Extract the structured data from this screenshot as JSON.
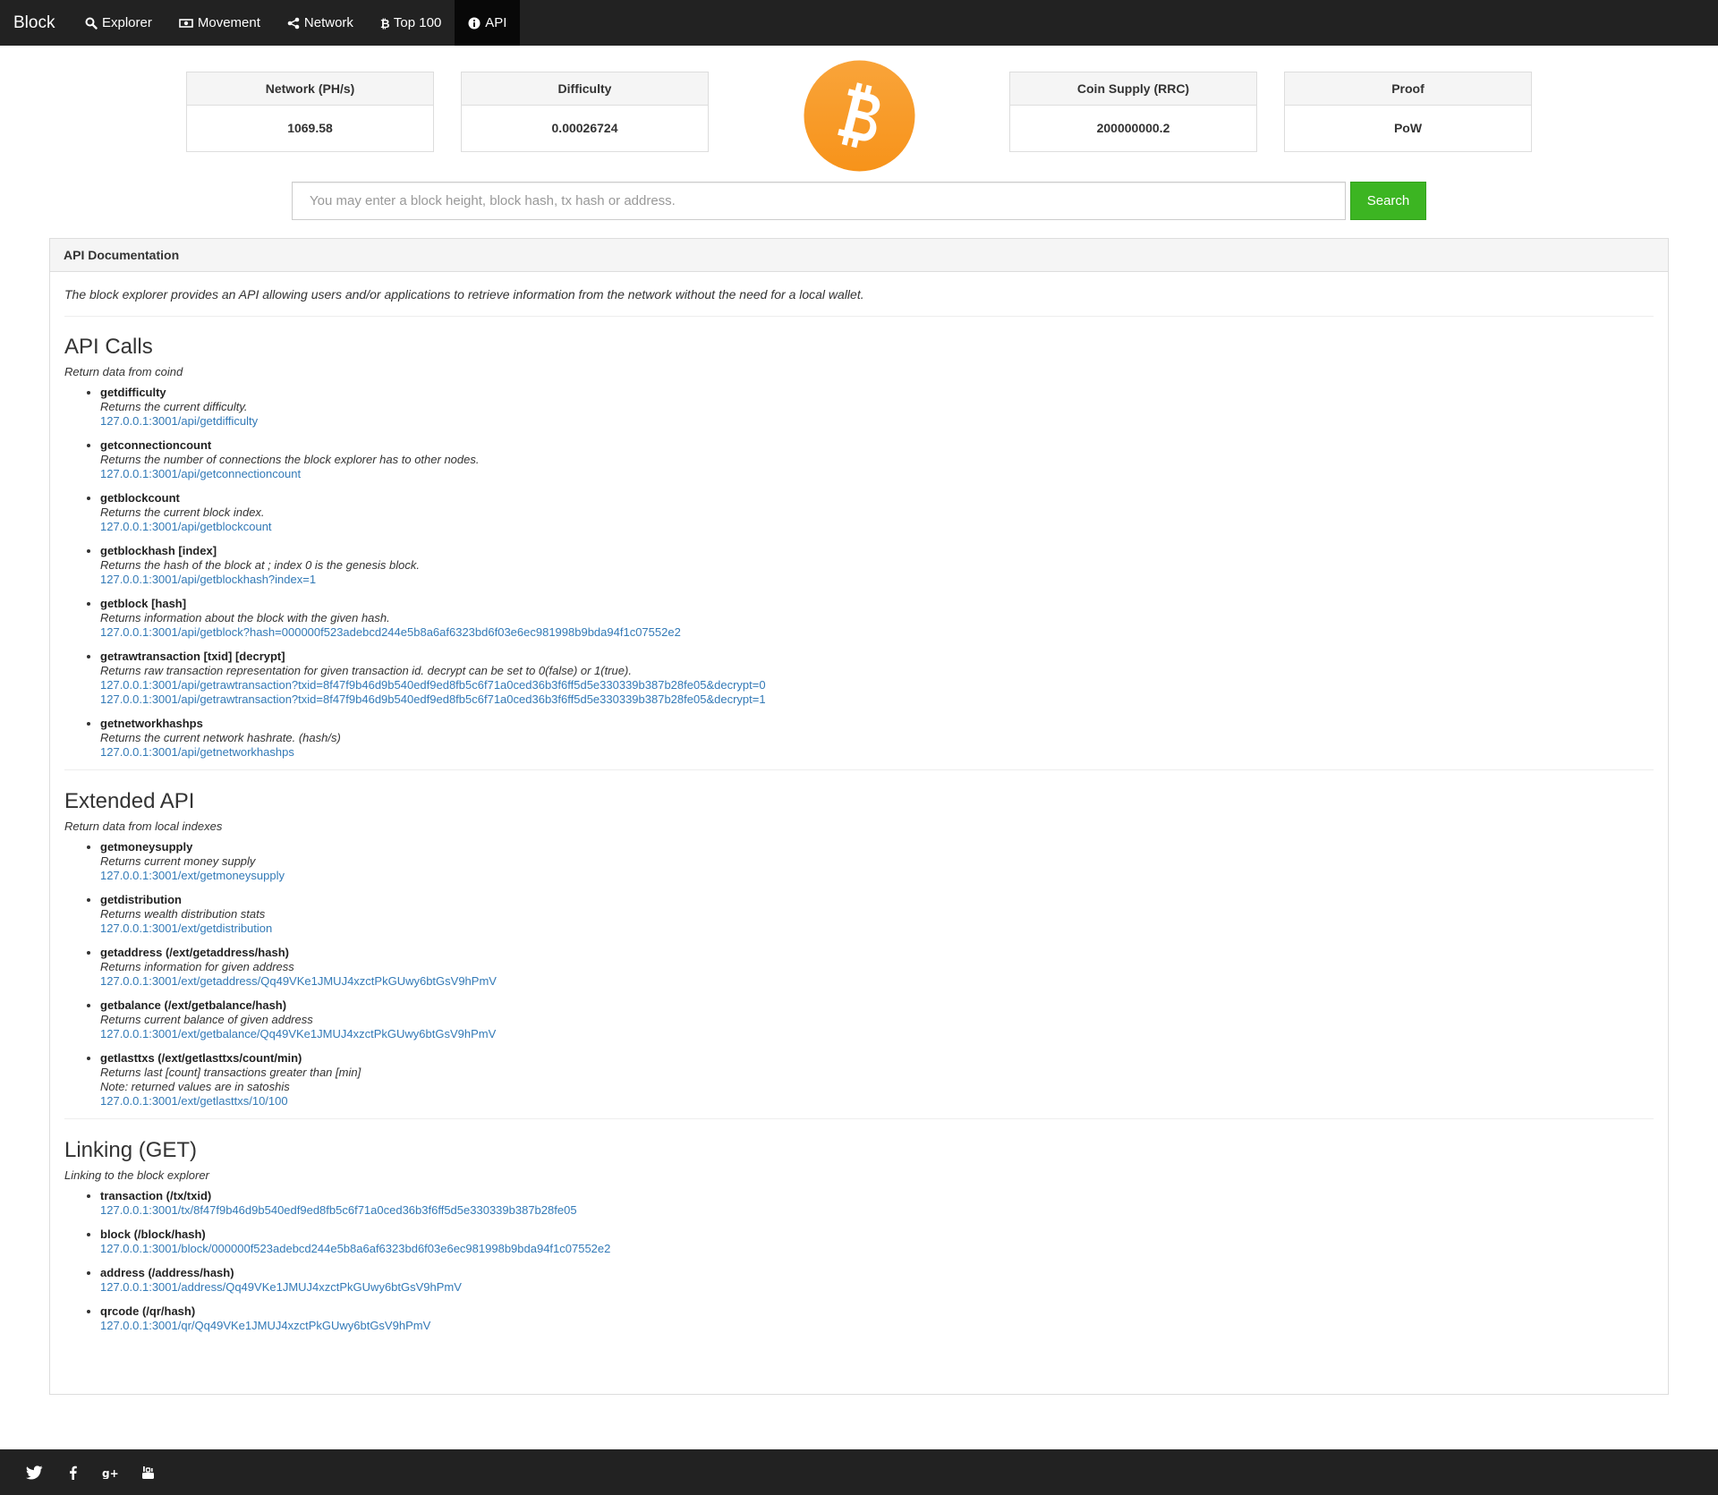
{
  "nav": {
    "brand": "Block",
    "items": [
      {
        "label": "Explorer",
        "icon": "search-icon"
      },
      {
        "label": "Movement",
        "icon": "money-icon"
      },
      {
        "label": "Network",
        "icon": "share-icon"
      },
      {
        "label": "Top 100",
        "icon": "bitcoin-icon"
      },
      {
        "label": "API",
        "icon": "info-circle-icon"
      }
    ],
    "active": "API"
  },
  "stats": [
    {
      "label": "Network (PH/s)",
      "value": "1069.58"
    },
    {
      "label": "Difficulty",
      "value": "0.00026724"
    },
    {
      "label": "Coin Supply (RRC)",
      "value": "200000000.2"
    },
    {
      "label": "Proof",
      "value": "PoW"
    }
  ],
  "logo": {
    "icon": "bitcoin-logo-icon",
    "color": "#f7931a"
  },
  "search": {
    "placeholder": "You may enter a block height, block hash, tx hash or address.",
    "button_label": "Search",
    "button_color": "#3cb522"
  },
  "panel": {
    "title": "API Documentation",
    "intro": "The block explorer provides an API allowing users and/or applications to retrieve information from the network without the need for a local wallet.",
    "sections": [
      {
        "heading": "API Calls",
        "subtitle": "Return data from coind",
        "items": [
          {
            "name": "getdifficulty",
            "desc": [
              "Returns the current difficulty."
            ],
            "links": [
              "127.0.0.1:3001/api/getdifficulty"
            ]
          },
          {
            "name": "getconnectioncount",
            "desc": [
              "Returns the number of connections the block explorer has to other nodes."
            ],
            "links": [
              "127.0.0.1:3001/api/getconnectioncount"
            ]
          },
          {
            "name": "getblockcount",
            "desc": [
              "Returns the current block index."
            ],
            "links": [
              "127.0.0.1:3001/api/getblockcount"
            ]
          },
          {
            "name": "getblockhash [index]",
            "desc": [
              "Returns the hash of the block at ; index 0 is the genesis block."
            ],
            "links": [
              "127.0.0.1:3001/api/getblockhash?index=1"
            ]
          },
          {
            "name": "getblock [hash]",
            "desc": [
              "Returns information about the block with the given hash."
            ],
            "links": [
              "127.0.0.1:3001/api/getblock?hash=000000f523adebcd244e5b8a6af6323bd6f03e6ec981998b9bda94f1c07552e2"
            ]
          },
          {
            "name": "getrawtransaction [txid] [decrypt]",
            "desc": [
              "Returns raw transaction representation for given transaction id. decrypt can be set to 0(false) or 1(true)."
            ],
            "links": [
              "127.0.0.1:3001/api/getrawtransaction?txid=8f47f9b46d9b540edf9ed8fb5c6f71a0ced36b3f6ff5d5e330339b387b28fe05&decrypt=0",
              "127.0.0.1:3001/api/getrawtransaction?txid=8f47f9b46d9b540edf9ed8fb5c6f71a0ced36b3f6ff5d5e330339b387b28fe05&decrypt=1"
            ]
          },
          {
            "name": "getnetworkhashps",
            "desc": [
              "Returns the current network hashrate. (hash/s)"
            ],
            "links": [
              "127.0.0.1:3001/api/getnetworkhashps"
            ]
          }
        ]
      },
      {
        "heading": "Extended API",
        "subtitle": "Return data from local indexes",
        "items": [
          {
            "name": "getmoneysupply",
            "desc": [
              "Returns current money supply"
            ],
            "links": [
              "127.0.0.1:3001/ext/getmoneysupply"
            ]
          },
          {
            "name": "getdistribution",
            "desc": [
              "Returns wealth distribution stats"
            ],
            "links": [
              "127.0.0.1:3001/ext/getdistribution"
            ]
          },
          {
            "name": "getaddress (/ext/getaddress/hash)",
            "desc": [
              "Returns information for given address"
            ],
            "links": [
              "127.0.0.1:3001/ext/getaddress/Qq49VKe1JMUJ4xzctPkGUwy6btGsV9hPmV"
            ]
          },
          {
            "name": "getbalance (/ext/getbalance/hash)",
            "desc": [
              "Returns current balance of given address"
            ],
            "links": [
              "127.0.0.1:3001/ext/getbalance/Qq49VKe1JMUJ4xzctPkGUwy6btGsV9hPmV"
            ]
          },
          {
            "name": "getlasttxs (/ext/getlasttxs/count/min)",
            "desc": [
              "Returns last [count] transactions greater than [min]",
              "Note: returned values are in satoshis"
            ],
            "links": [
              "127.0.0.1:3001/ext/getlasttxs/10/100"
            ]
          }
        ]
      },
      {
        "heading": "Linking (GET)",
        "subtitle": "Linking to the block explorer",
        "items": [
          {
            "name": "transaction (/tx/txid)",
            "desc": [],
            "links": [
              "127.0.0.1:3001/tx/8f47f9b46d9b540edf9ed8fb5c6f71a0ced36b3f6ff5d5e330339b387b28fe05"
            ]
          },
          {
            "name": "block (/block/hash)",
            "desc": [],
            "links": [
              "127.0.0.1:3001/block/000000f523adebcd244e5b8a6af6323bd6f03e6ec981998b9bda94f1c07552e2"
            ]
          },
          {
            "name": "address (/address/hash)",
            "desc": [],
            "links": [
              "127.0.0.1:3001/address/Qq49VKe1JMUJ4xzctPkGUwy6btGsV9hPmV"
            ]
          },
          {
            "name": "qrcode (/qr/hash)",
            "desc": [],
            "links": [
              "127.0.0.1:3001/qr/Qq49VKe1JMUJ4xzctPkGUwy6btGsV9hPmV"
            ]
          }
        ]
      }
    ]
  },
  "footer": {
    "social": [
      "twitter-icon",
      "facebook-icon",
      "google-plus-icon",
      "youtube-icon"
    ]
  }
}
